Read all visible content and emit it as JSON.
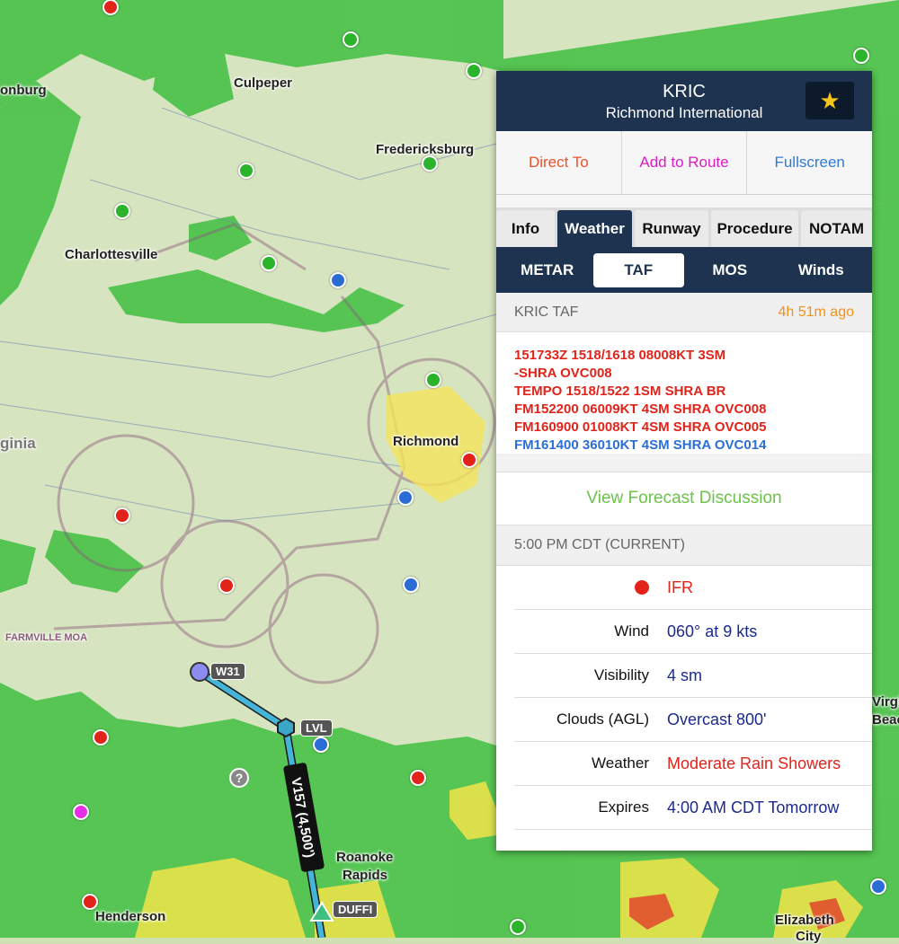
{
  "map": {
    "labels": [
      "Culpeper",
      "Fredericksburg",
      "Charlottesville",
      "Richmond",
      "Roanoke",
      "Rapids",
      "Henderson",
      "Elizabeth",
      "onburg",
      "ginia",
      "FARMVILLE MOA",
      "Virgin",
      "Beac",
      "City"
    ],
    "waypoints": [
      "W31",
      "LVL",
      "DUFFI"
    ],
    "airway": "V157 (4,500')",
    "colors": {
      "vfr": "#2bb32b",
      "mvfr": "#2a6bd6",
      "ifr": "#e2231a",
      "lifr": "#e62ee6",
      "route": "#3aa7c9"
    }
  },
  "panel": {
    "ident": "KRIC",
    "name": "Richmond International",
    "favorite_icon": "star-icon",
    "actions": {
      "direct_to": "Direct To",
      "add_to_route": "Add to Route",
      "fullscreen": "Fullscreen"
    },
    "tabs": [
      "Info",
      "Weather",
      "Runway",
      "Procedure",
      "NOTAM"
    ],
    "active_tab": "Weather",
    "subtabs": [
      "METAR",
      "TAF",
      "MOS",
      "Winds"
    ],
    "active_subtab": "TAF",
    "taf": {
      "title": "KRIC TAF",
      "age": "4h 51m ago",
      "lines": [
        "151733Z 1518/1618 08008KT 3SM",
        "-SHRA OVC008",
        "TEMPO 1518/1522 1SM SHRA BR",
        "FM152200 06009KT 4SM SHRA OVC008",
        "FM160900 01008KT 4SM SHRA OVC005",
        "FM161400 36010KT 4SM SHRA OVC014"
      ]
    },
    "forecast_discussion": "View Forecast Discussion",
    "current": {
      "heading": "5:00 PM CDT (CURRENT)",
      "category": "IFR",
      "wind_label": "Wind",
      "wind": "060° at 9 kts",
      "visibility_label": "Visibility",
      "visibility": "4 sm",
      "clouds_label": "Clouds (AGL)",
      "clouds": "Overcast 800'",
      "weather_label": "Weather",
      "weather": "Moderate Rain Showers",
      "expires_label": "Expires",
      "expires": "4:00 AM CDT Tomorrow"
    }
  }
}
